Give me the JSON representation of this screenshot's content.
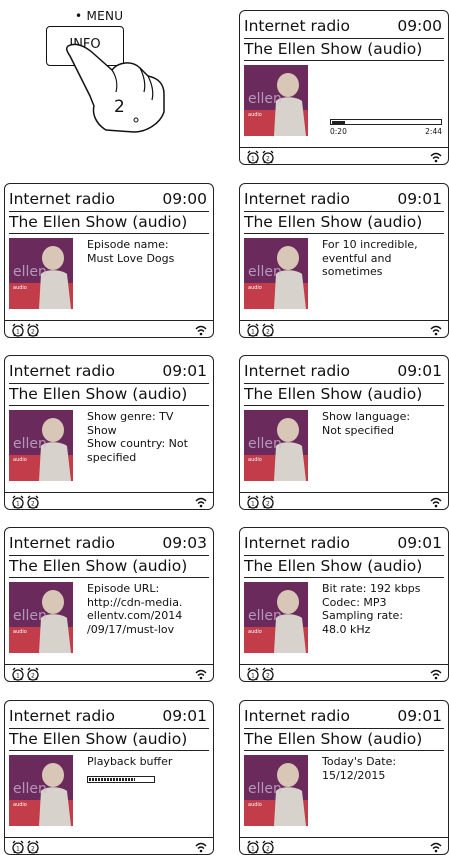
{
  "instruction": {
    "menu_label": "• MENU",
    "button_label": "INFO",
    "step_number": "2"
  },
  "colors": {
    "art_background": "#6a2a5c",
    "art_stripe": "#c23c4a",
    "art_person": "#d8d2cc"
  },
  "screens": [
    {
      "source": "Internet radio",
      "time": "09:00",
      "station": "The Ellen Show (audio)",
      "info": "",
      "progress": {
        "elapsed": "0:20",
        "total": "2:44",
        "fraction": 0.12
      }
    },
    {
      "source": "Internet radio",
      "time": "09:00",
      "station": "The Ellen Show (audio)",
      "info": "Episode name:\nMust Love Dogs"
    },
    {
      "source": "Internet radio",
      "time": "09:01",
      "station": "The Ellen Show (audio)",
      "info": "For 10 incredible,\neventful and\nsometimes"
    },
    {
      "source": "Internet radio",
      "time": "09:01",
      "station": "The Ellen Show (audio)",
      "info": "Show genre: TV\nShow\nShow country: Not\nspecified"
    },
    {
      "source": "Internet radio",
      "time": "09:01",
      "station": "The Ellen Show (audio)",
      "info": "Show language:\nNot specified"
    },
    {
      "source": "Internet radio",
      "time": "09:03",
      "station": "The Ellen Show (audio)",
      "info": "Episode URL:\nhttp://cdn-media.\nellentv.com/2014\n/09/17/must-lov"
    },
    {
      "source": "Internet radio",
      "time": "09:01",
      "station": "The Ellen Show (audio)",
      "info": "Bit rate: 192 kbps\nCodec: MP3\nSampling rate:\n48.0 kHz"
    },
    {
      "source": "Internet radio",
      "time": "09:01",
      "station": "The Ellen Show (audio)",
      "info": "Playback buffer",
      "buffer_fraction": 0.72
    },
    {
      "source": "Internet radio",
      "time": "09:01",
      "station": "The Ellen Show (audio)",
      "info": "Today's Date:\n15/12/2015"
    }
  ],
  "icons": {
    "alarm": "alarm-clock-icon",
    "wifi": "wifi-signal-icon"
  }
}
